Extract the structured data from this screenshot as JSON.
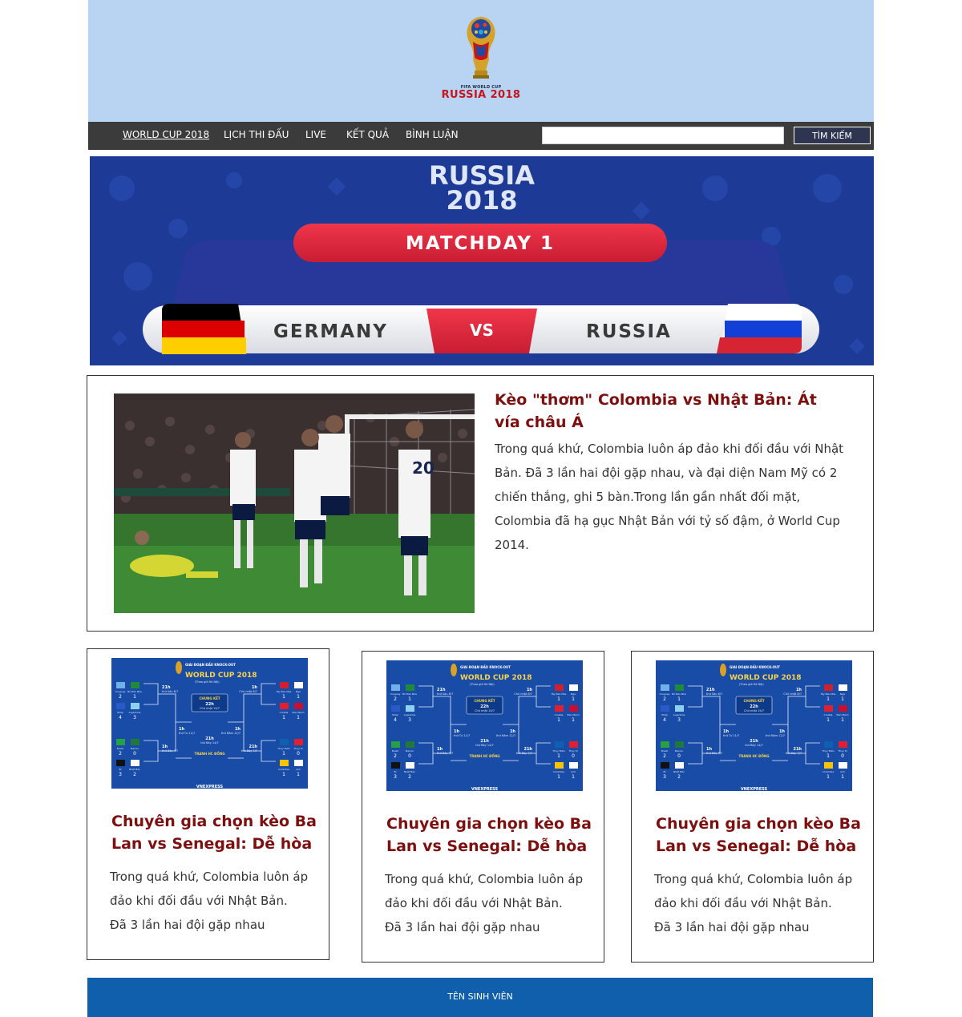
{
  "header": {
    "logo_line1": "FIFA WORLD CUP",
    "logo_line2": "RUSSIA 2018"
  },
  "nav": {
    "items": [
      {
        "label": "WORLD CUP 2018"
      },
      {
        "label": "LỊCH THI ĐẤU"
      },
      {
        "label": "LIVE"
      },
      {
        "label": "KẾT QUẢ"
      },
      {
        "label": "BÌNH LUẬN"
      }
    ],
    "search_value": "",
    "search_button": "TÌM KIẾM"
  },
  "banner": {
    "title_line1": "RUSSIA",
    "title_line2": "2018",
    "matchday": "MATCHDAY 1",
    "team_left": "GERMANY",
    "vs": "VS",
    "team_right": "RUSSIA"
  },
  "featured": {
    "title": "Kèo \"thơm\" Colombia vs Nhật Bản: Át vía châu Á",
    "text": "Trong quá khứ, Colombia luôn áp đảo khi đối đầu với Nhật Bản. Đã 3 lần hai đội gặp nhau, và đại diện Nam Mỹ có 2 chiến thắng, ghi 5 bàn.Trong lần gần nhất đối mặt, Colombia đã hạ gục Nhật Bản với tỷ số đậm, ở World Cup 2014."
  },
  "bracket": {
    "stage": "GIAI ĐOẠN ĐẤU KNOCK-OUT",
    "title": "WORLD CUP 2018",
    "subtitle": "(Theo giờ Hà Nội)",
    "final_label": "CHUNG KẾT",
    "final_time": "22h",
    "final_date": "Chủ nhật 15/7",
    "third_time": "21h",
    "third_date": "thứ Bảy 14/7",
    "third_label": "TRANH HC ĐỒNG",
    "brand": "VNEXPRESS",
    "left_teams": [
      "Uruguay",
      "Bồ Đào Nha",
      "Pháp",
      "Argentina",
      "Brazil",
      "Mexico",
      "Bỉ",
      "Nhật Bản"
    ],
    "right_teams": [
      "Tây Ban Nha",
      "Nga",
      "Croatia",
      "Đan Mạch",
      "Thụy Điển",
      "Thụy Sĩ",
      "Colombia",
      "Anh"
    ],
    "left_scores": [
      [
        "2",
        "1"
      ],
      [
        "4",
        "3"
      ],
      [
        "2",
        "0"
      ],
      [
        "3",
        "2"
      ]
    ],
    "right_scores": [
      [
        "1",
        "1"
      ],
      [
        "1",
        "1"
      ],
      [
        "1",
        "0"
      ],
      [
        "1",
        "1"
      ]
    ],
    "left_qf": [
      {
        "time": "21h",
        "date": "thứ Sáu 6/7"
      },
      {
        "time": "1h",
        "date": "thứ Bảy 7/7"
      }
    ],
    "right_qf": [
      {
        "time": "1h",
        "date": "Chủ nhật 8/7"
      },
      {
        "time": "21h",
        "date": "thứ Bảy 7/7"
      }
    ],
    "left_sf": {
      "time": "1h",
      "date": "thứ Tư 11/7"
    },
    "right_sf": {
      "time": "1h",
      "date": "thứ Năm 12/7"
    }
  },
  "cards": [
    {
      "title": "Chuyên gia chọn kèo Ba Lan vs Senegal: Dễ hòa",
      "line1": "Trong quá khứ, Colombia luôn áp",
      "line2": "đảo khi đối đầu với Nhật Bản.",
      "line3": "Đã 3 lần hai đội gặp nhau"
    },
    {
      "title": "Chuyên gia chọn kèo Ba Lan vs Senegal: Dễ hòa",
      "line1": "Trong quá khứ, Colombia luôn áp",
      "line2": "đảo khi đối đầu với Nhật Bản.",
      "line3": "Đã 3 lần hai đội gặp nhau"
    },
    {
      "title": "Chuyên gia chọn kèo Ba Lan vs Senegal: Dễ hòa",
      "line1": "Trong quá khứ, Colombia luôn áp",
      "line2": "đảo khi đối đầu với Nhật Bản.",
      "line3": "Đã 3 lần hai đội gặp nhau"
    }
  ],
  "footer": {
    "text": "TÊN SINH VIÊN"
  },
  "colors": {
    "header_bg": "#b8d4f2",
    "nav_bg": "#3b3b3b",
    "title_red": "#7e0f0f",
    "footer_bg": "#0f5fad",
    "banner_bg": "#1d3a96"
  }
}
